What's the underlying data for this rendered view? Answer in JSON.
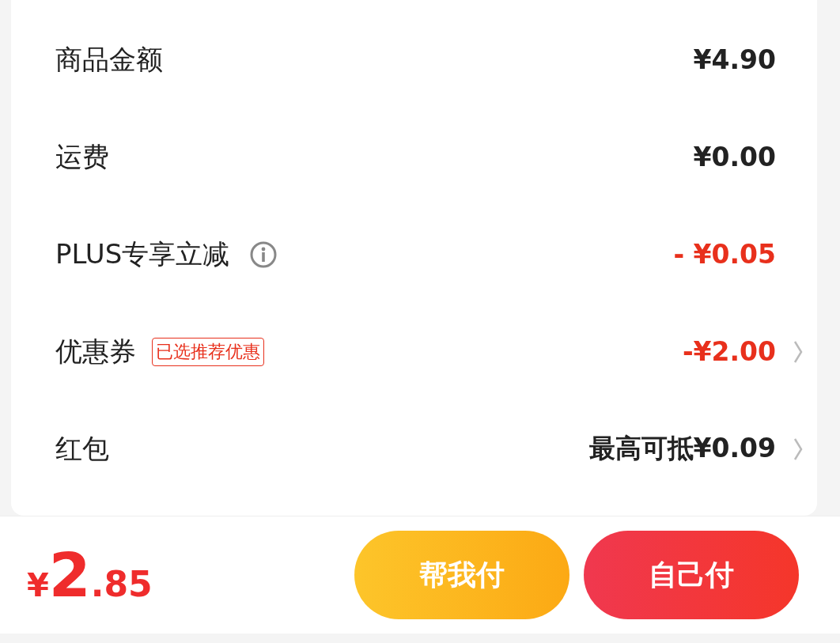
{
  "rows": [
    {
      "label": "商品金额",
      "value": "¥4.90",
      "highlight": false,
      "info": false,
      "arrow": false
    },
    {
      "label": "运费",
      "value": "¥0.00",
      "highlight": false,
      "info": false,
      "arrow": false
    },
    {
      "label": "PLUS专享立减",
      "value": "- ¥0.05",
      "highlight": true,
      "info": true,
      "arrow": false
    },
    {
      "label": "优惠券",
      "tag": "已选推荐优惠",
      "value": "-¥2.00",
      "highlight": true,
      "info": false,
      "arrow": true
    },
    {
      "label": "红包",
      "value": "最高可抵¥0.09",
      "highlight": false,
      "info": false,
      "arrow": true
    }
  ],
  "total": {
    "currency": "¥",
    "integer": "2",
    "decimal": ".85"
  },
  "buttons": [
    {
      "label": "帮我付",
      "kind": "secondary"
    },
    {
      "label": "自己付",
      "kind": "primary"
    }
  ]
}
